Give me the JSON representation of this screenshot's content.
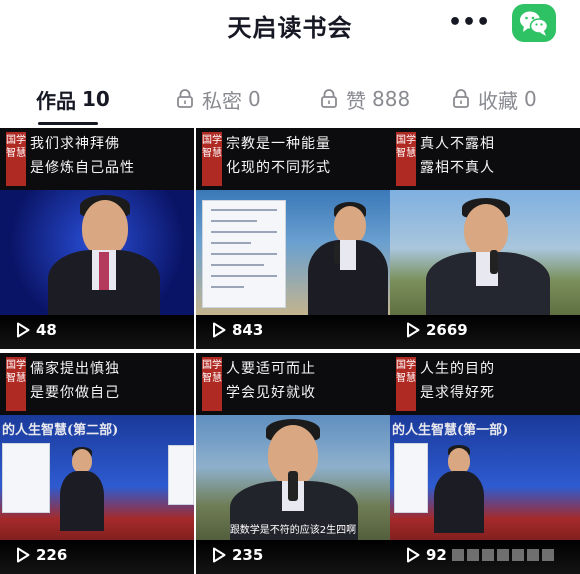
{
  "header": {
    "title": "天启读书会",
    "more_icon": "more-dots-icon",
    "share_icon": "wechat-icon",
    "share_color": "#2fc265"
  },
  "tabs": [
    {
      "label": "作品",
      "count": "10",
      "locked": false,
      "active": true
    },
    {
      "label": "私密",
      "count": "0",
      "locked": true,
      "active": false
    },
    {
      "label": "赞",
      "count": "888",
      "locked": true,
      "active": false
    },
    {
      "label": "收藏",
      "count": "0",
      "locked": true,
      "active": false
    }
  ],
  "badge_text": "国学智慧",
  "videos": [
    {
      "caption_line1": "我们求神拜佛",
      "caption_line2": "是修炼自己品性",
      "plays": "48",
      "subtitle": ""
    },
    {
      "caption_line1": "宗教是一种能量",
      "caption_line2": "化现的不同形式",
      "plays": "843",
      "subtitle": ""
    },
    {
      "caption_line1": "真人不露相",
      "caption_line2": "露相不真人",
      "plays": "2669",
      "subtitle": ""
    },
    {
      "caption_line1": "儒家提出慎独",
      "caption_line2": "是要你做自己",
      "plays": "226",
      "subtitle": ""
    },
    {
      "caption_line1": "人要适可而止",
      "caption_line2": "学会见好就收",
      "plays": "235",
      "subtitle": "跟数学是不符的应该2生四啊"
    },
    {
      "caption_line1": "人生的目的",
      "caption_line2": "是求得好死",
      "plays": "92",
      "subtitle": ""
    }
  ],
  "backdrop_texts": [
    "的人生智慧(第二部)",
    "的人生智慧(第一部)"
  ],
  "play_icon": "play-icon",
  "lock_icon": "lock-icon"
}
